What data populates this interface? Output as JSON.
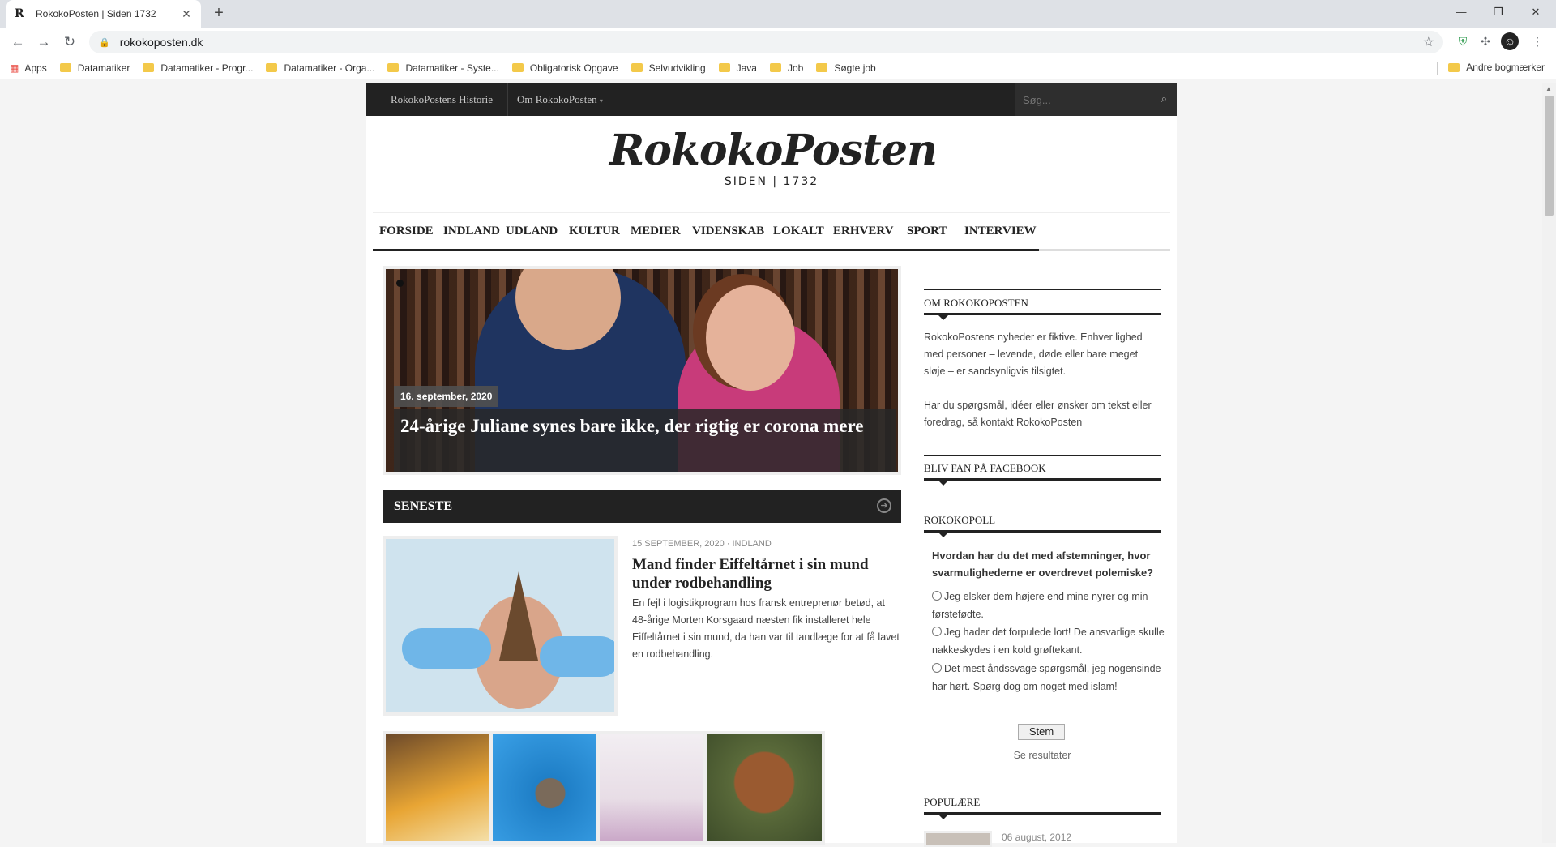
{
  "browser": {
    "tab_title": "RokokoPosten | Siden 1732",
    "tab_favicon": "R",
    "url": "rokokoposten.dk",
    "bookmarks": [
      "Apps",
      "Datamatiker",
      "Datamatiker - Progr...",
      "Datamatiker - Orga...",
      "Datamatiker - Syste...",
      "Obligatorisk Opgave",
      "Selvudvikling",
      "Java",
      "Job",
      "Søgte job"
    ],
    "other_bookmarks": "Andre bogmærker"
  },
  "site": {
    "top_links": [
      "RokokoPostens Historie",
      "Om RokokoPosten"
    ],
    "search_placeholder": "Søg...",
    "logo_name": "RokokoPosten",
    "logo_since": "SIDEN | 1732",
    "nav": [
      "FORSIDE",
      "INDLAND",
      "UDLAND",
      "KULTUR",
      "MEDIER",
      "VIDENSKAB",
      "LOKALT",
      "ERHVERV",
      "SPORT",
      "INTERVIEW"
    ]
  },
  "feature": {
    "date": "16. september, 2020",
    "title": "24-årige Juliane synes bare ikke, der rigtig er corona mere"
  },
  "latest": {
    "section_title": "SENESTE",
    "meta": "15 SEPTEMBER, 2020 · INDLAND",
    "headline": "Mand finder Eiffeltårnet i sin mund under rodbehandling",
    "excerpt": "En fejl i logistikprogram hos fransk entreprenør betød, at 48-årige Morten Korsgaard næsten fik installeret hele Eiffeltårnet i sin mund, da han var til tandlæge for at få lavet en rodbehandling."
  },
  "sidebar": {
    "about_title": "OM ROKOKOPOSTEN",
    "about_text1": "RokokoPostens nyheder er fiktive. Enhver lighed med personer – levende, døde eller bare meget sløje – er sandsynligvis tilsigtet.",
    "about_text2_pre": "Har du spørgsmål, idéer eller ønsker om tekst eller foredrag, så ",
    "about_text2_link": "kontakt RokokoPosten",
    "facebook_title": "BLIV FAN PÅ FACEBOOK",
    "poll_title": "ROKOKOPOLL",
    "poll_question": "Hvordan har du det med afstemninger, hvor svarmulighederne er overdrevet polemiske?",
    "poll_options": [
      "Jeg elsker dem højere end mine nyrer og min førstefødte.",
      "Jeg hader det forpulede lort! De ansvarlige skulle nakkeskydes i en kold grøftekant.",
      "Det mest åndssvage spørgsmål, jeg nogensinde har hørt. Spørg dog om noget med islam!"
    ],
    "vote_label": "Stem",
    "results_label": "Se resultater",
    "popular_title": "POPULÆRE",
    "popular_date": "06 august, 2012"
  },
  "colors": {
    "topbar": "#222222",
    "accent": "#222222",
    "bookmark_folder": "#f3c94a"
  }
}
